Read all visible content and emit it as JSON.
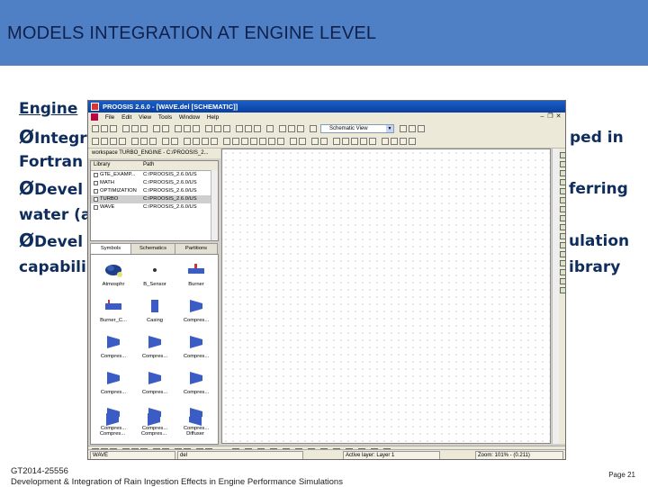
{
  "slide": {
    "title": "MODELS INTEGRATION AT ENGINE LEVEL",
    "body_lines": [
      {
        "text": "Engine",
        "bullet": false,
        "underline": true
      },
      {
        "text": "Integr",
        "tail": "ped in",
        "bullet": true
      },
      {
        "text": "Fortran",
        "bullet": false
      },
      {
        "text": "Devel",
        "tail": "ferring",
        "bullet": true
      },
      {
        "text": "water (a",
        "bullet": false
      },
      {
        "text": "Devel",
        "tail": "ulation",
        "bullet": true
      },
      {
        "text": "capabili",
        "tail": "ibrary",
        "bullet": false
      }
    ],
    "bullet_glyph": "Ø",
    "footer_code": "GT2014-25556",
    "footer_title": "Development & Integration of Rain Ingestion Effects in Engine Performance Simulations",
    "page_label": "Page 21"
  },
  "app": {
    "window_title": "PROOSIS 2.6.0 - [WAVE.del [SCHEMATIC]]",
    "menu": [
      "File",
      "Edit",
      "View",
      "Tools",
      "Window",
      "Help"
    ],
    "view_combo": "Schematic View",
    "workspace_label": "workspace  TURBO_ENGINE - C:/PROOSIS_2...",
    "library_headers": [
      "Library",
      "Path"
    ],
    "library_rows": [
      {
        "name": "GTE_EXAMP...",
        "path": "C:/PROOSIS_2.6.0/US",
        "selected": false
      },
      {
        "name": "MATH",
        "path": "C:/PROOSIS_2.6.0/US",
        "selected": false
      },
      {
        "name": "OPTIMIZATION",
        "path": "C:/PROOSIS_2.6.0/US",
        "selected": false
      },
      {
        "name": "TURBO",
        "path": "C:/PROOSIS_2.6.0/US",
        "selected": true
      },
      {
        "name": "WAVE",
        "path": "C:/PROOSIS_2.6.0/US",
        "selected": false
      }
    ],
    "tabs": [
      "Symbols",
      "Schematics",
      "Partitions"
    ],
    "palette": [
      "Atmosphr",
      "B_Sensor",
      "Burner",
      "Burner_C...",
      "Casing",
      "Compres...",
      "Compres...",
      "Compres...",
      "Compres...",
      "Compres...",
      "Compres...",
      "Compres...",
      "Compres...",
      "Compres...",
      "Compres...",
      "Compres...",
      "Compres...",
      "Diffuser"
    ],
    "status": {
      "left": "WAVE",
      "middle": "del",
      "layer": "Active layer: Layer 1",
      "zoom": "Zoom: 101% - (0.211)"
    },
    "colors": {
      "banner": "#4f80c6",
      "body_text": "#0f2d5c",
      "title_text": "#10204a",
      "titlebar": "#1a5fc8"
    }
  }
}
